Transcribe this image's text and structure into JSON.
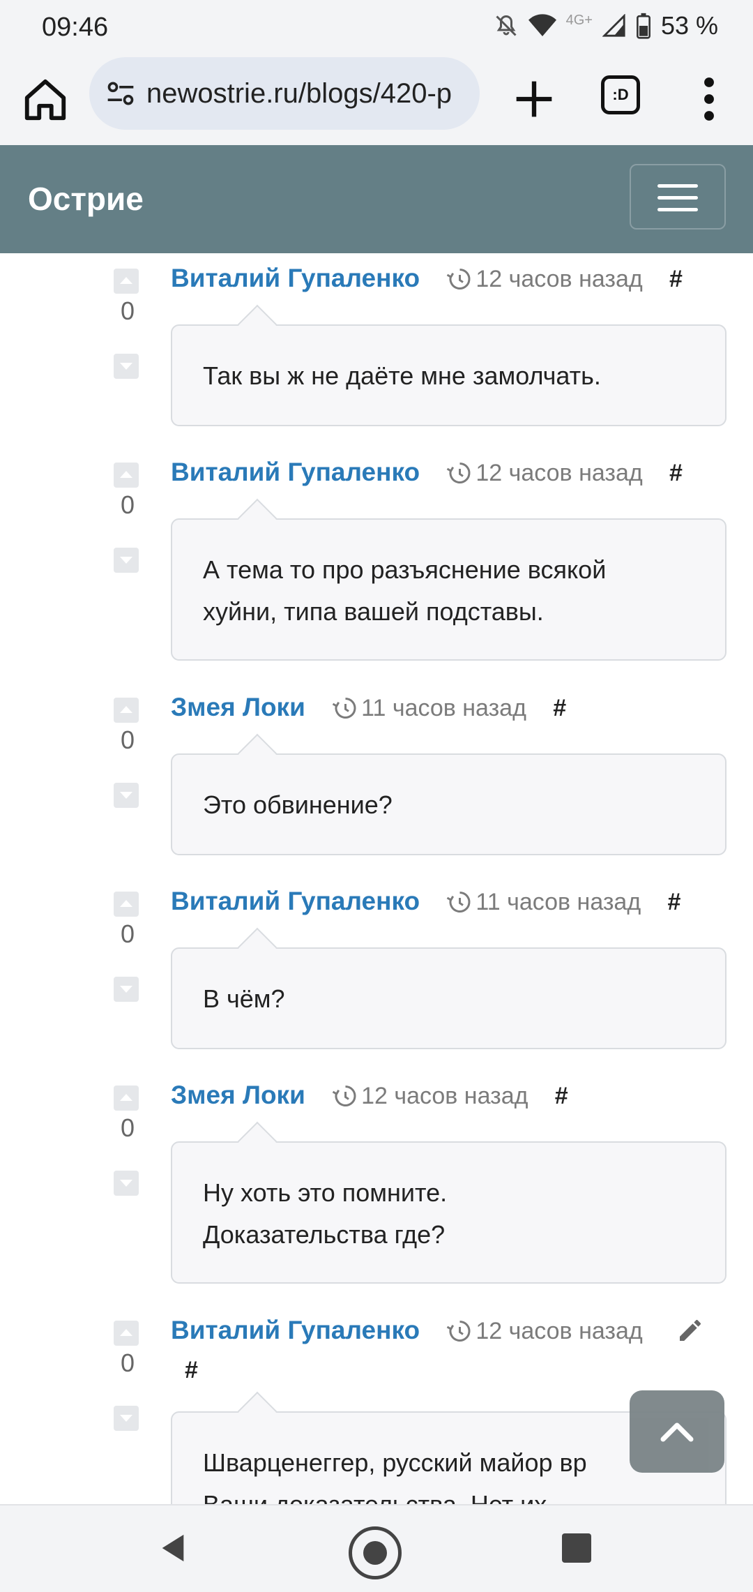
{
  "status_bar": {
    "time": "09:46",
    "network_label": "4G+",
    "battery": "53 %"
  },
  "browser": {
    "url": "newostrie.ru/blogs/420-р",
    "tabs_label": ":D"
  },
  "site": {
    "brand": "Острие"
  },
  "comments": [
    {
      "author": "Виталий Гупаленко",
      "time": "12 часов назад",
      "hash": "#",
      "score": "0",
      "lines": [
        "Так вы ж не даёте мне замолчать."
      ]
    },
    {
      "author": "Виталий Гупаленко",
      "time": "12 часов назад",
      "hash": "#",
      "score": "0",
      "lines": [
        "А тема то про разъяснение всякой",
        "хуйни, типа вашей подставы."
      ]
    },
    {
      "author": "Змея Локи",
      "time": "11 часов назад",
      "hash": "#",
      "score": "0",
      "lines": [
        "Это обвинение?"
      ]
    },
    {
      "author": "Виталий Гупаленко",
      "time": "11 часов назад",
      "hash": "#",
      "score": "0",
      "lines": [
        "В чём?"
      ]
    },
    {
      "author": "Змея Локи",
      "time": "12 часов назад",
      "hash": "#",
      "score": "0",
      "lines": [
        "Ну хоть это помните.",
        "Доказательства где?"
      ]
    },
    {
      "author": "Виталий Гупаленко",
      "time": "12 часов назад",
      "hash": "#",
      "score": "0",
      "lines": [
        "Шварценеггер, русский майор вр",
        "Ваши доказательства. Нет их."
      ]
    }
  ]
}
